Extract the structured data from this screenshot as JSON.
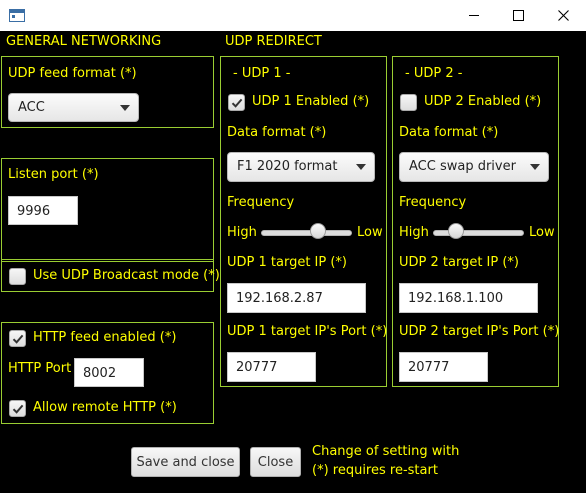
{
  "window": {
    "title": ""
  },
  "general": {
    "heading": "GENERAL NETWORKING",
    "udp_feed_format_label": "UDP feed format (*)",
    "udp_feed_format_value": "ACC",
    "listen_port_label": "Listen port (*)",
    "listen_port_value": "9996",
    "broadcast_label": "Use UDP Broadcast mode (*)",
    "broadcast_checked": false,
    "http_feed_label": "HTTP feed enabled (*)",
    "http_feed_checked": true,
    "http_port_label": "HTTP Port",
    "http_port_value": "8002",
    "allow_remote_label": "Allow remote HTTP (*)",
    "allow_remote_checked": true
  },
  "redirect": {
    "heading": "UDP REDIRECT",
    "udp1": {
      "title": "- UDP 1 -",
      "enabled_label": "UDP 1 Enabled (*)",
      "enabled_checked": true,
      "data_format_label": "Data format (*)",
      "data_format_value": "F1 2020 format",
      "frequency_label": "Frequency",
      "high_label": "High",
      "low_label": "Low",
      "frequency_position": 0.63,
      "target_ip_label": "UDP 1 target IP (*)",
      "target_ip_value": "192.168.2.87",
      "target_port_label": "UDP 1 target IP's Port (*)",
      "target_port_value": "20777"
    },
    "udp2": {
      "title": "- UDP 2 -",
      "enabled_label": "UDP 2 Enabled (*)",
      "enabled_checked": false,
      "data_format_label": "Data format (*)",
      "data_format_value": "ACC swap driver",
      "frequency_label": "Frequency",
      "high_label": "High",
      "low_label": "Low",
      "frequency_position": 0.25,
      "target_ip_label": "UDP 2 target IP (*)",
      "target_ip_value": "192.168.1.100",
      "target_port_label": "UDP 2 target IP's Port (*)",
      "target_port_value": "20777"
    }
  },
  "footer": {
    "save_label": "Save and close",
    "close_label": "Close",
    "note_line1": "Change of setting with",
    "note_line2": "(*) requires re-start"
  },
  "colors": {
    "label": "#ffff00",
    "group_border": "#9acd32",
    "background": "#000000"
  }
}
